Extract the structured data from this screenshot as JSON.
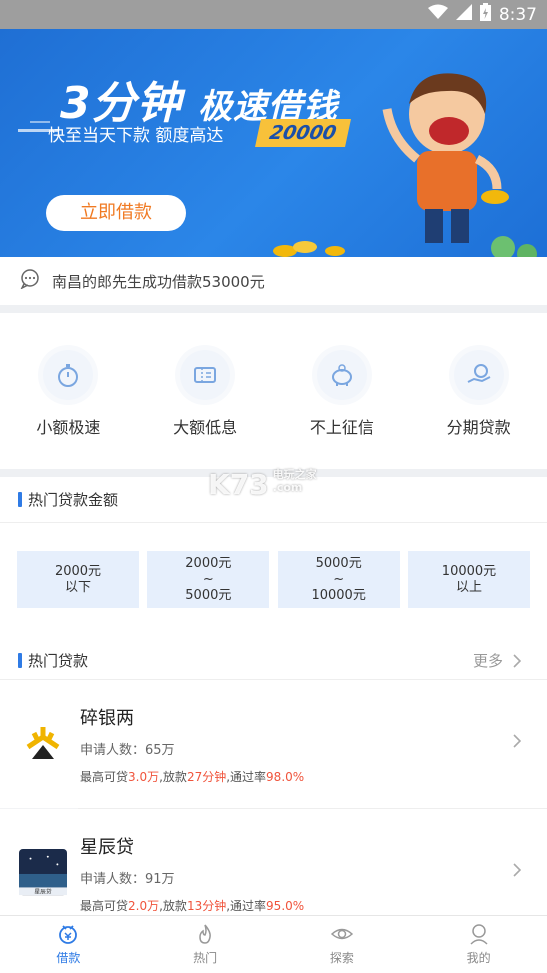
{
  "status_bar": {
    "time": "8:37"
  },
  "banner": {
    "title_main": "3分钟",
    "title_sub": "极速借钱",
    "subtitle": "快至当天下款  额度高达",
    "amount": "20000",
    "cta": "立即借款"
  },
  "notice": {
    "text": "南昌的郎先生成功借款53000元"
  },
  "features": [
    {
      "label": "小额极速"
    },
    {
      "label": "大额低息"
    },
    {
      "label": "不上征信"
    },
    {
      "label": "分期贷款"
    }
  ],
  "hot_amounts": {
    "title": "热门贷款金额",
    "items": [
      {
        "line1": "2000元",
        "line2": "以下",
        "line3": ""
      },
      {
        "line1": "2000元",
        "line2": "~",
        "line3": "5000元"
      },
      {
        "line1": "5000元",
        "line2": "~",
        "line3": "10000元"
      },
      {
        "line1": "10000元",
        "line2": "以上",
        "line3": ""
      }
    ]
  },
  "hot_loans": {
    "title": "热门贷款",
    "more": "更多",
    "items": [
      {
        "name": "碎银两",
        "apply": "申请人数：65万",
        "s1": "最高可贷",
        "v1": "3.0万",
        "s2": ",放款",
        "v2": "27分钟",
        "s3": ",通过率",
        "v3": "98.0%"
      },
      {
        "name": "星辰贷",
        "apply": "申请人数：91万",
        "s1": "最高可贷",
        "v1": "2.0万",
        "s2": ",放款",
        "v2": "13分钟",
        "s3": ",通过率",
        "v3": "95.0%",
        "logo_text": "星辰贷"
      }
    ]
  },
  "watermark": {
    "brand": "K73",
    "line1": "电玩之家",
    "line2": ".com"
  },
  "tabbar": [
    {
      "label": "借款",
      "icon": "loan-icon",
      "active": true
    },
    {
      "label": "热门",
      "icon": "flame-icon",
      "active": false
    },
    {
      "label": "探索",
      "icon": "eye-icon",
      "active": false
    },
    {
      "label": "我的",
      "icon": "user-icon",
      "active": false
    }
  ],
  "colors": {
    "accent": "#2f7be5",
    "highlight": "#f0543c",
    "banner": "#1f6fd4",
    "cta_text": "#f07a23"
  }
}
